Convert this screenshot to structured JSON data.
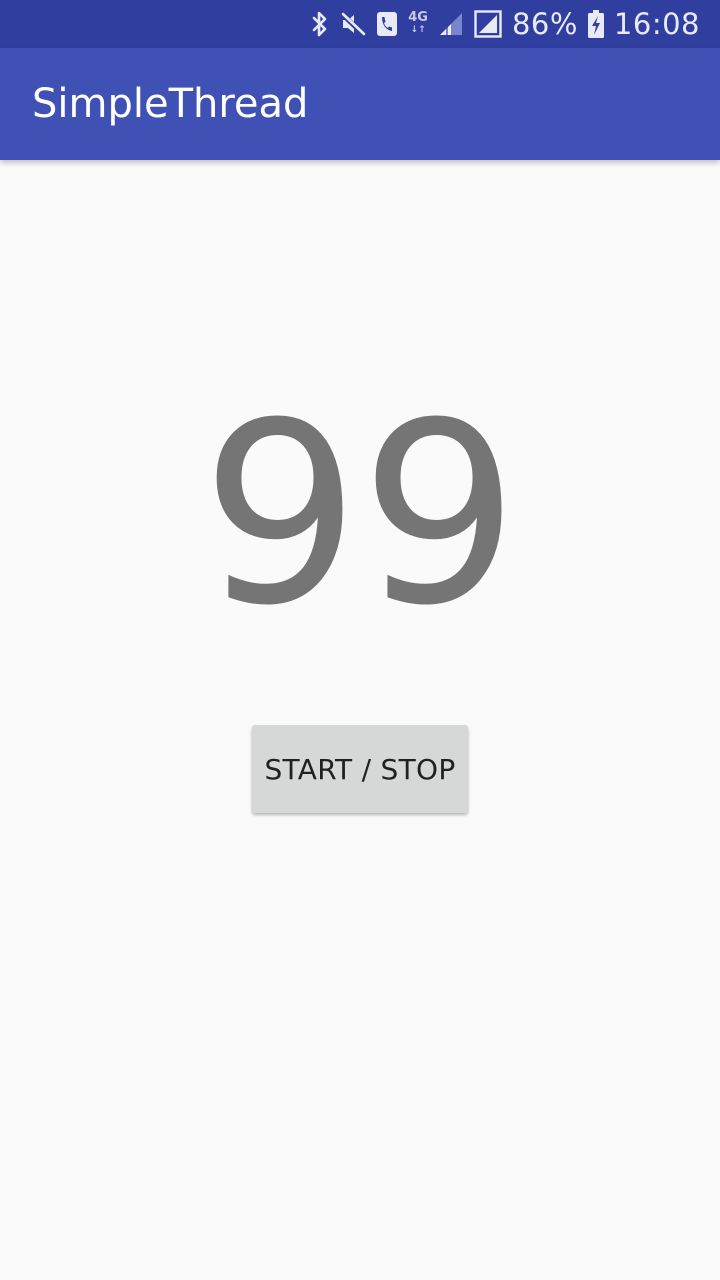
{
  "status_bar": {
    "network_type": "4G",
    "battery_percent": "86%",
    "time": "16:08",
    "icons": [
      "bluetooth-icon",
      "mute-icon",
      "call-icon",
      "network-4g-icon",
      "signal-weak-icon",
      "signal-full-icon",
      "battery-charging-icon"
    ]
  },
  "app_bar": {
    "title": "SimpleThread",
    "background_color": "#3f51b5",
    "status_bar_color": "#303f9f"
  },
  "main": {
    "counter_value": "99",
    "button_label": "START / STOP"
  }
}
